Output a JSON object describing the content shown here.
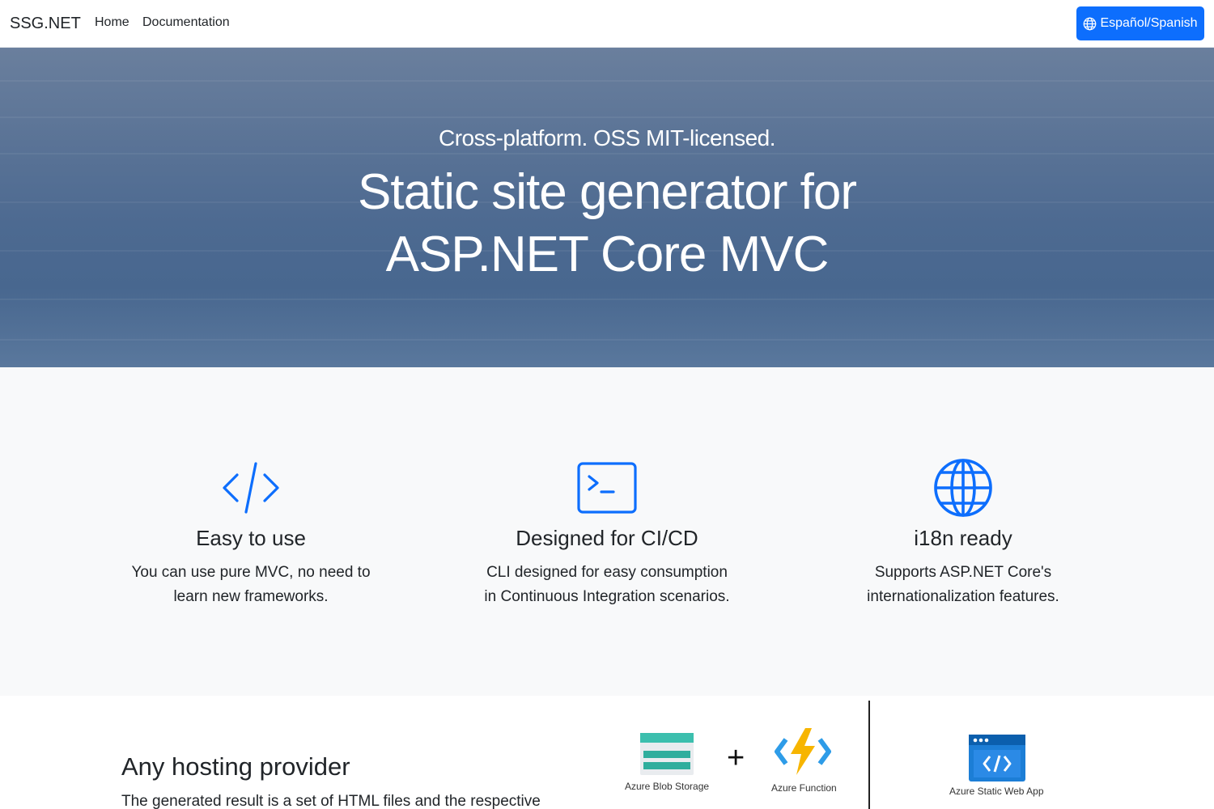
{
  "navbar": {
    "brand": "SSG.NET",
    "links": [
      "Home",
      "Documentation"
    ],
    "language_button": "Español/Spanish",
    "language_icon": "globe-icon",
    "accent_color": "#0d6efd"
  },
  "hero": {
    "subtitle": "Cross-platform. OSS MIT-licensed.",
    "title_line1": "Static site generator for",
    "title_line2": "ASP.NET Core MVC"
  },
  "features": [
    {
      "icon": "code-icon",
      "title": "Easy to use",
      "line1": "You can use pure MVC, no need to",
      "line2": "learn new frameworks."
    },
    {
      "icon": "terminal-icon",
      "title": "Designed for CI/CD",
      "line1": "CLI designed for easy consumption",
      "line2": "in Continuous Integration scenarios."
    },
    {
      "icon": "globe-icon",
      "title": "i18n ready",
      "line1": "Supports ASP.NET Core's",
      "line2": "internationalization features."
    }
  ],
  "hosting": {
    "title": "Any hosting provider",
    "text": "The generated result is a set of HTML files and the respective",
    "diagram": {
      "blob_label": "Azure Blob Storage",
      "plus": "+",
      "function_label": "Azure Function",
      "static_app_label": "Azure Static Web App"
    }
  }
}
